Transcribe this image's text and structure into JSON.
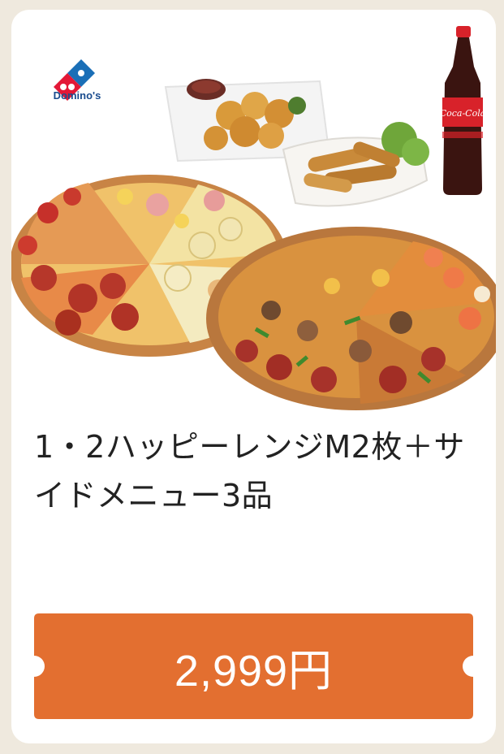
{
  "brand": {
    "name": "Domino's"
  },
  "coupon": {
    "title": "1・2ハッピーレンジM2枚＋サイドメニュー3品",
    "price": "2,999円",
    "bottle_label": "Coca-Cola"
  },
  "colors": {
    "page_background": "#efe9de",
    "card_background": "#ffffff",
    "price_ticket": "#e36f30",
    "brand_blue": "#1a6fb7",
    "brand_red": "#e31837"
  },
  "icons": [
    "dominos-logo-icon"
  ]
}
